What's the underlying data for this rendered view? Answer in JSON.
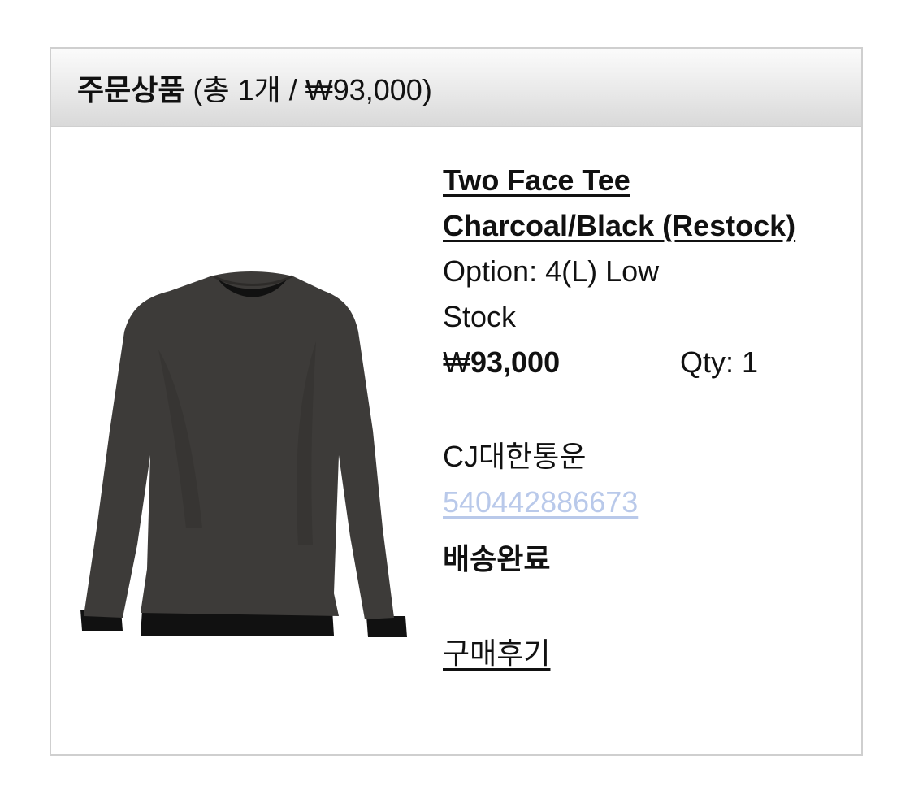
{
  "header": {
    "title": "주문상품",
    "summary": "(총 1개 / ₩93,000)"
  },
  "product": {
    "name": "Two Face Tee Charcoal/Black (Restock)",
    "option_line1": "Option: 4(L) Low",
    "option_line2": "Stock",
    "price_symbol": "₩",
    "price_amount": "93,000",
    "qty": "Qty: 1"
  },
  "shipping": {
    "carrier": "CJ대한통운",
    "tracking_number": "540442886673",
    "status": "배송완료"
  },
  "actions": {
    "review_label": "구매후기"
  },
  "colors": {
    "tracking_link": "#b9c9ea",
    "shirt_body": "#3d3b39",
    "shirt_layer": "#111111"
  }
}
